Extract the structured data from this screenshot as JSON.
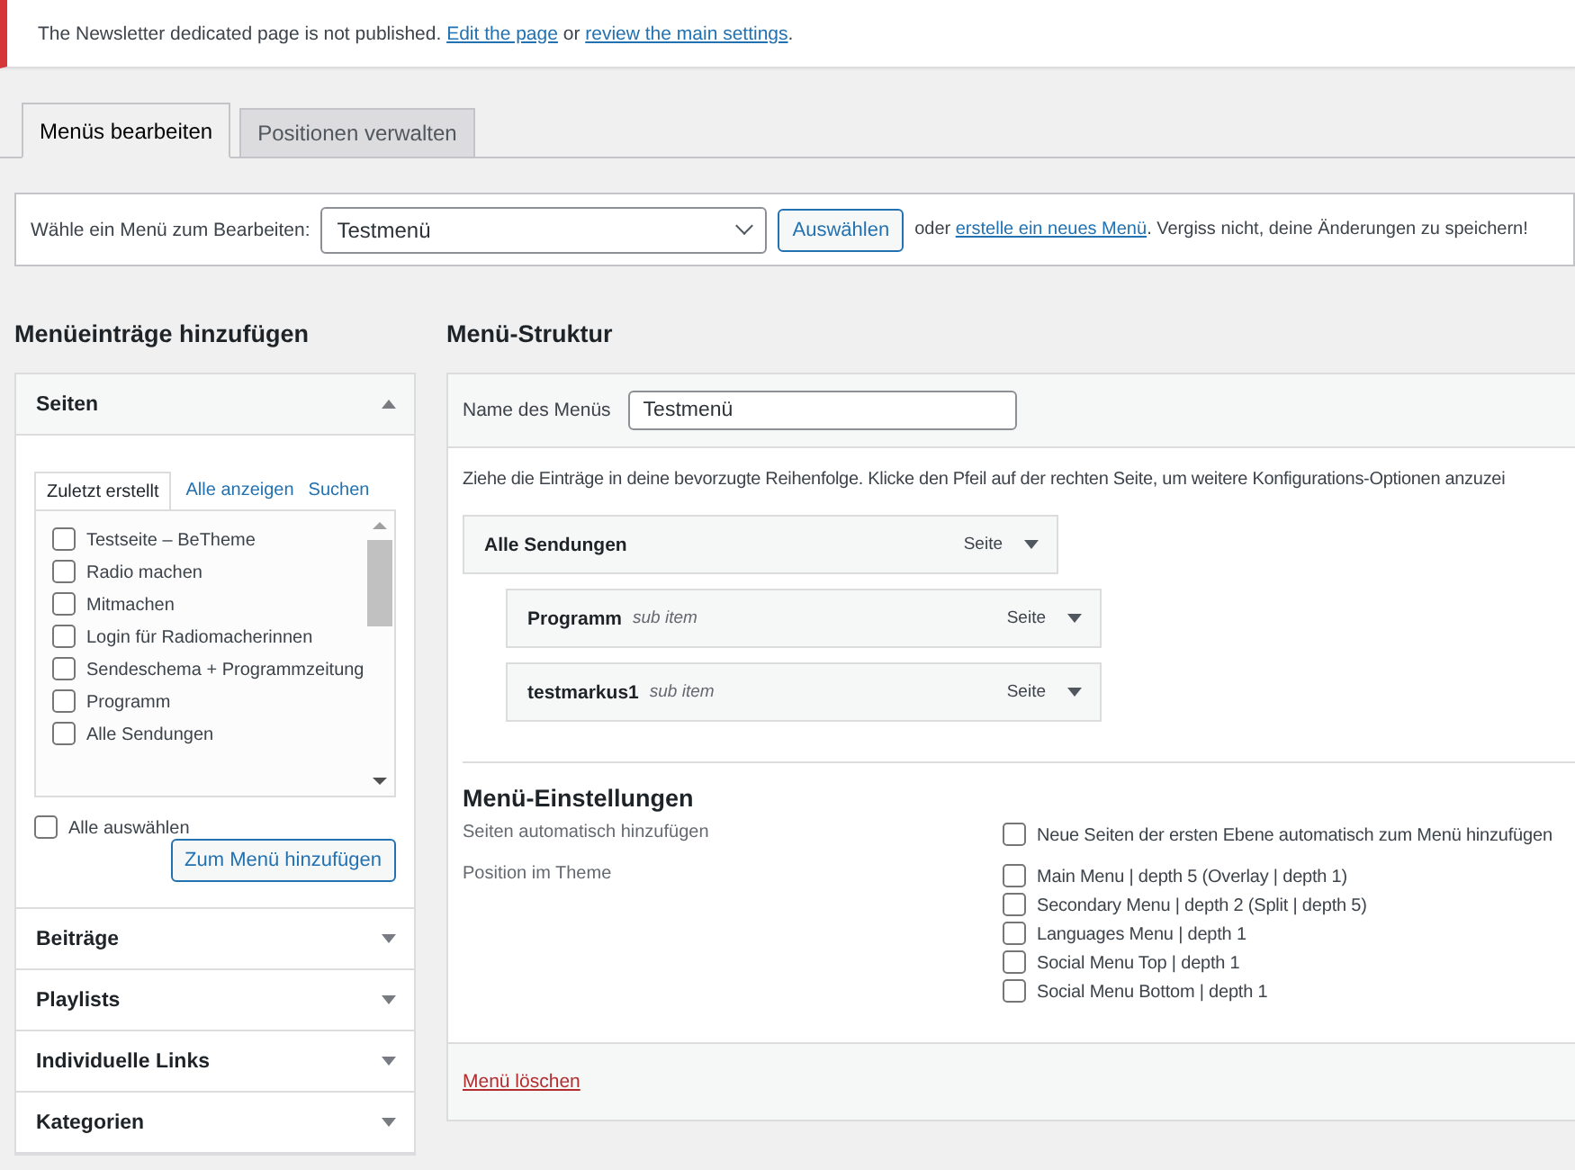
{
  "notice": {
    "parts": [
      {
        "kind": "text",
        "text": "The Newsletter dedicated page is not published. "
      },
      {
        "kind": "link",
        "text": "Edit the page"
      },
      {
        "kind": "text",
        "text": " or "
      },
      {
        "kind": "link",
        "text": "review the main settings"
      },
      {
        "kind": "text",
        "text": "."
      }
    ]
  },
  "tabs": [
    {
      "label": "Menüs bearbeiten",
      "selected": true
    },
    {
      "label": "Positionen verwalten",
      "selected": false
    }
  ],
  "manage": {
    "label": "Wähle ein Menü zum Bearbeiten:",
    "select_value": "Testmenü",
    "button": "Auswählen",
    "note": [
      {
        "kind": "text",
        "text": "oder "
      },
      {
        "kind": "link",
        "text": "erstelle ein neues Menü"
      },
      {
        "kind": "text",
        "text": ". Vergiss nicht, deine Änderungen zu speichern!"
      }
    ]
  },
  "left": {
    "title": "Menüeinträge hinzufügen",
    "sections": [
      {
        "title": "Seiten",
        "expanded": true,
        "tabs": [
          {
            "label": "Zuletzt erstellt",
            "selected": true
          },
          {
            "label": "Alle anzeigen",
            "selected": false
          },
          {
            "label": "Suchen",
            "selected": false
          }
        ],
        "pages": [
          {
            "label": "Testseite – BeTheme",
            "checked": false
          },
          {
            "label": "Radio machen",
            "checked": false
          },
          {
            "label": "Mitmachen",
            "checked": false
          },
          {
            "label": "Login für Radiomacherinnen",
            "checked": false
          },
          {
            "label": "Sendeschema + Programmzeitung",
            "checked": false
          },
          {
            "label": "Programm",
            "checked": false
          },
          {
            "label": "Alle Sendungen",
            "checked": false
          }
        ],
        "select_all": {
          "label": "Alle auswählen",
          "checked": false
        },
        "add_button": "Zum Menü hinzufügen"
      },
      {
        "title": "Beiträge",
        "expanded": false
      },
      {
        "title": "Playlists",
        "expanded": false
      },
      {
        "title": "Individuelle Links",
        "expanded": false
      },
      {
        "title": "Kategorien",
        "expanded": false
      }
    ]
  },
  "right": {
    "title": "Menü-Struktur",
    "name_label": "Name des Menüs",
    "name_value": "Testmenü",
    "instructions": "Ziehe die Einträge in deine bevorzugte Reihenfolge. Klicke den Pfeil auf der rechten Seite, um weitere Konfigurations-Optionen anzuzei",
    "items": [
      {
        "title": "Alle Sendungen",
        "type": "Seite",
        "children": [
          {
            "title": "Programm",
            "note": "sub item",
            "type": "Seite"
          },
          {
            "title": "testmarkus1",
            "note": "sub item",
            "type": "Seite"
          }
        ]
      }
    ],
    "settings": {
      "title": "Menü-Einstellungen",
      "rows": [
        {
          "label": "Seiten automatisch hinzufügen",
          "options": [
            {
              "label": "Neue Seiten der ersten Ebene automatisch zum Menü hinzufügen",
              "checked": false
            }
          ]
        },
        {
          "label": "Position im Theme",
          "options": [
            {
              "label": "Main Menu | depth 5 (Overlay | depth 1)",
              "checked": false
            },
            {
              "label": "Secondary Menu | depth 2 (Split | depth 5)",
              "checked": false
            },
            {
              "label": "Languages Menu | depth 1",
              "checked": false
            },
            {
              "label": "Social Menu Top | depth 1",
              "checked": false
            },
            {
              "label": "Social Menu Bottom | depth 1",
              "checked": false
            }
          ]
        }
      ]
    },
    "delete_link": "Menü löschen"
  }
}
